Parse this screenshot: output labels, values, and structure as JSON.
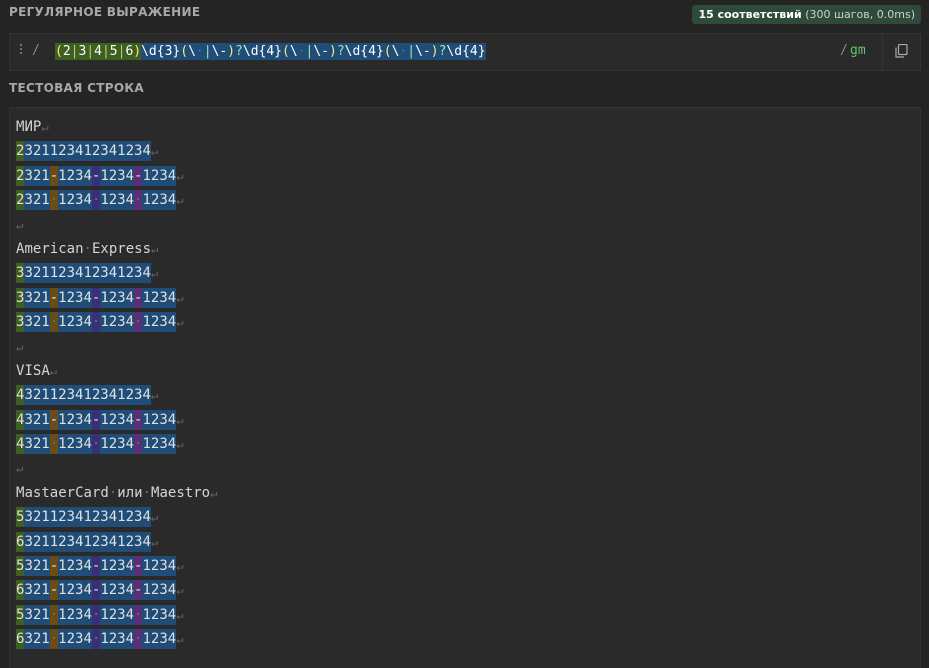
{
  "regex_section": {
    "label": "РЕГУЛЯРНОЕ ВЫРАЖЕНИЕ",
    "match_count": "15 соответствий",
    "match_meta": "(300 шагов, 0.0ms)",
    "open_delim": "/",
    "close_delim": "/",
    "flags": "gm",
    "pattern": "(2|3|4|5|6)\\d{3}(\\ |\\-)?\\d{4}(\\ |\\-)?\\d{4}(\\ |\\-)?\\d{4}"
  },
  "test_section": {
    "label": "ТЕСТОВАЯ СТРОКА",
    "lines": [
      "МИР",
      "2321123412341234",
      "2321-1234-1234-1234",
      "2321 1234 1234 1234",
      "",
      "American Express",
      "3321123412341234",
      "3321-1234-1234-1234",
      "3321 1234 1234 1234",
      "",
      "VISA",
      "4321123412341234",
      "4321-1234-1234-1234",
      "4321 1234 1234 1234",
      "",
      "MastaerCard или Maestro",
      "5321123412341234",
      "6321123412341234",
      "5321-1234-1234-1234",
      "6321-1234-1234-1234",
      "5321 1234 1234 1234",
      "6321 1234 1234 1234"
    ]
  },
  "colors": {
    "background": "#242424",
    "group_match": "#3e5e22",
    "full_match": "#1f4d78",
    "separator_1": "#6b4b16",
    "separator_2": "#3b2e78",
    "separator_3": "#5b2e78",
    "flags": "#66c46b",
    "badge": "#2d4a3a"
  },
  "icons": {
    "drag": "drag-handle-icon",
    "copy": "copy-icon"
  }
}
